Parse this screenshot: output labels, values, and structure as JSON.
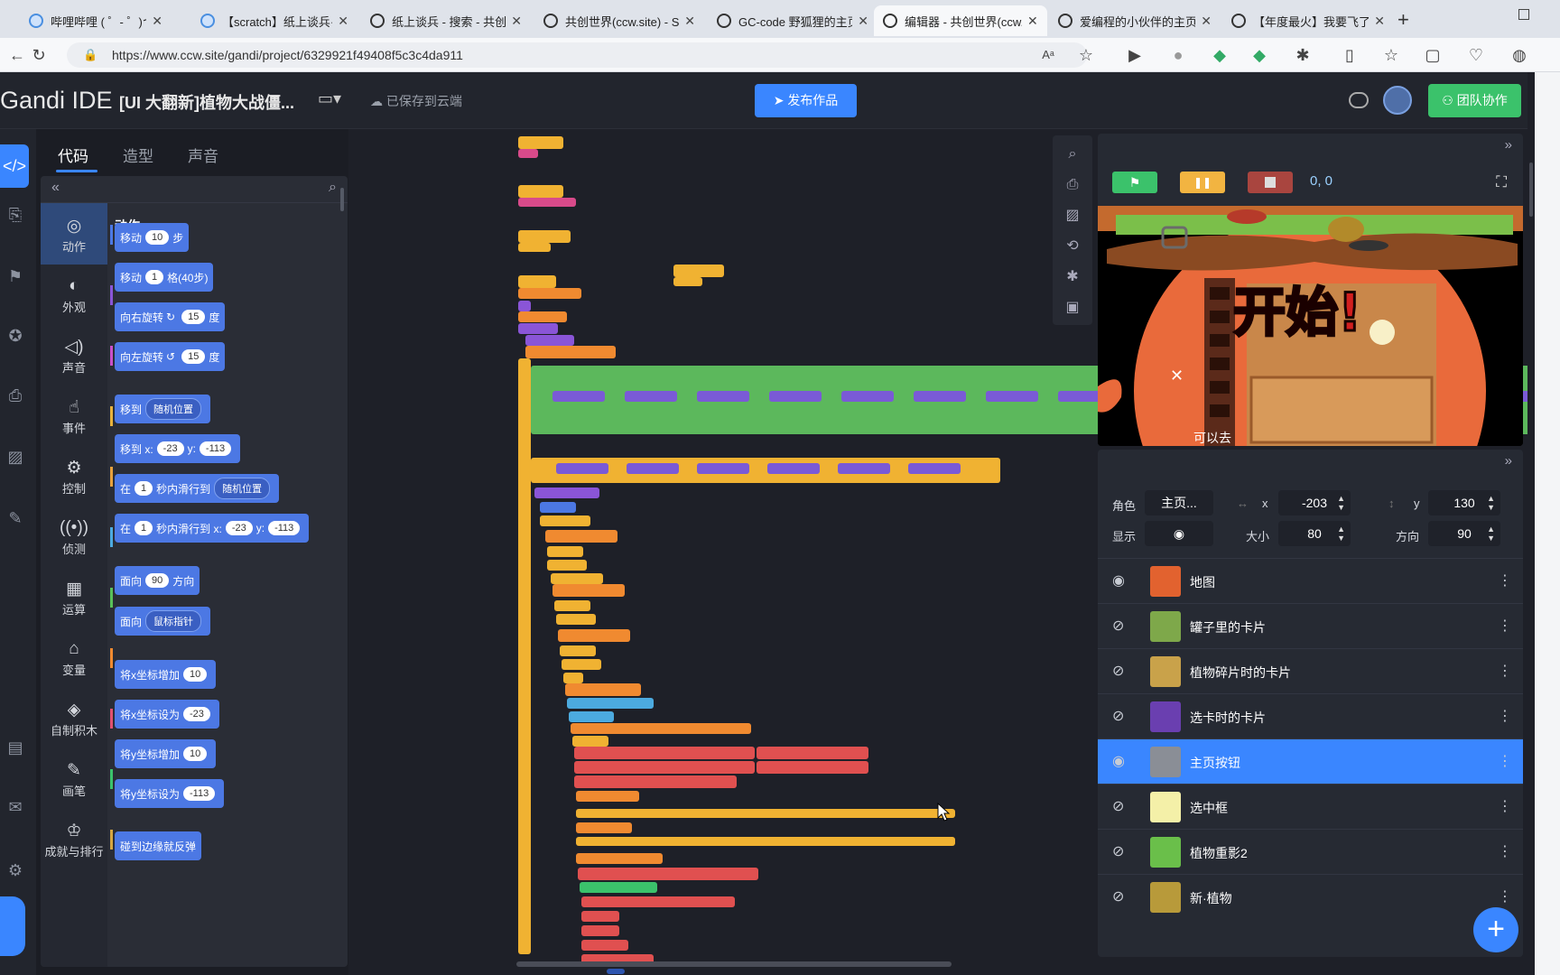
{
  "browser": {
    "tabs": [
      {
        "label": "哔哩哔哩 ( ゜- ゜)つロ 千杯~",
        "favicon": "bilibili-icon"
      },
      {
        "label": "【scratch】纸上谈兵·共创世界",
        "favicon": "bilibili-icon"
      },
      {
        "label": "纸上谈兵 - 搜索 - 共创世界",
        "favicon": "ccw-icon"
      },
      {
        "label": "共创世界(ccw.site) - Scratch",
        "favicon": "ccw-icon"
      },
      {
        "label": "GC-code 野狐狸的主页",
        "favicon": "ccw-icon"
      },
      {
        "label": "编辑器 - 共创世界(ccw.site)",
        "favicon": "ccw-icon",
        "active": true
      },
      {
        "label": "爱编程的小伙伴的主页",
        "favicon": "ccw-icon"
      },
      {
        "label": "【年度最火】我要飞了",
        "favicon": "ccw-icon"
      }
    ],
    "url": "https://www.ccw.site/gandi/project/6329921f49408f5c3c4da911"
  },
  "header": {
    "logo": "Gandi IDE",
    "project_title": "[UI 大翻新]植物大战僵...",
    "saved_status": "已保存到云端",
    "publish_label": "发布作品",
    "collab_label": "团队协作"
  },
  "editor_tabs": [
    "代码",
    "造型",
    "声音"
  ],
  "categories": [
    {
      "label": "动作",
      "icon": "motion-icon",
      "color": "#4c78e4",
      "active": true
    },
    {
      "label": "外观",
      "icon": "palette-icon",
      "color": "#8a55d7"
    },
    {
      "label": "声音",
      "icon": "sound-icon",
      "color": "#c94fc9"
    },
    {
      "label": "事件",
      "icon": "event-icon",
      "color": "#e8b23c"
    },
    {
      "label": "控制",
      "icon": "control-icon",
      "color": "#e8a13c"
    },
    {
      "label": "侦测",
      "icon": "sensing-icon",
      "color": "#4caadf"
    },
    {
      "label": "运算",
      "icon": "operator-icon",
      "color": "#59c059"
    },
    {
      "label": "变量",
      "icon": "variable-icon",
      "color": "#f08a30"
    },
    {
      "label": "自制积木",
      "icon": "myblocks-icon",
      "color": "#e05070"
    },
    {
      "label": "画笔",
      "icon": "pen-icon",
      "color": "#3bc26b"
    },
    {
      "label": "成就与排行",
      "icon": "trophy-icon",
      "color": "#d6a640"
    }
  ],
  "palette": {
    "section_title": "动作",
    "blocks": {
      "move": {
        "pre": "移动",
        "v": "10",
        "post": "步"
      },
      "move_grid": {
        "pre": "移动",
        "v": "1",
        "post": "格(40步)"
      },
      "turn_right": {
        "pre": "向右旋转",
        "v": "15",
        "post": "度"
      },
      "turn_left": {
        "pre": "向左旋转",
        "v": "15",
        "post": "度"
      },
      "goto": {
        "pre": "移到",
        "dd": "随机位置"
      },
      "goto_xy": {
        "pre": "移到 x:",
        "x": "-23",
        "mid": "y:",
        "y": "-113"
      },
      "glide_to": {
        "pre": "在",
        "v": "1",
        "mid": "秒内滑行到",
        "dd": "随机位置"
      },
      "glide_xy": {
        "pre": "在",
        "v": "1",
        "mid": "秒内滑行到 x:",
        "x": "-23",
        "mid2": "y:",
        "y": "-113"
      },
      "point_dir": {
        "pre": "面向",
        "v": "90",
        "post": "方向"
      },
      "point_towards": {
        "pre": "面向",
        "dd": "鼠标指针"
      },
      "change_x": {
        "pre": "将x坐标增加",
        "v": "10"
      },
      "set_x": {
        "pre": "将x坐标设为",
        "v": "-23"
      },
      "change_y": {
        "pre": "将y坐标增加",
        "v": "10"
      },
      "set_y": {
        "pre": "将y坐标设为",
        "v": "-113"
      },
      "bounce": {
        "pre": "碰到边缘就反弹"
      }
    }
  },
  "stage": {
    "coords": "0, 0",
    "overlay_text": "开始!",
    "hover_text": "可以去"
  },
  "sprite_info": {
    "labels": {
      "sprite": "角色",
      "show": "显示",
      "size": "大小",
      "direction": "方向",
      "x": "x",
      "y": "y"
    },
    "name": "主页...",
    "x": "-203",
    "y": "130",
    "size": "80",
    "direction": "90"
  },
  "sprites": [
    {
      "name": "地图",
      "visible": true,
      "thumb_color": "#e2622f"
    },
    {
      "name": "罐子里的卡片",
      "visible": false,
      "thumb_color": "#7ea84a"
    },
    {
      "name": "植物碎片时的卡片",
      "visible": false,
      "thumb_color": "#c9a24a"
    },
    {
      "name": "选卡时的卡片",
      "visible": false,
      "thumb_color": "#6a3fb0"
    },
    {
      "name": "主页按钮",
      "visible": true,
      "thumb_color": "#8a8e96",
      "selected": true
    },
    {
      "name": "选中框",
      "visible": false,
      "thumb_color": "#f4f0a8"
    },
    {
      "name": "植物重影2",
      "visible": false,
      "thumb_color": "#6abf4a"
    },
    {
      "name": "新·植物",
      "visible": false,
      "thumb_color": "#b89a3a"
    }
  ]
}
